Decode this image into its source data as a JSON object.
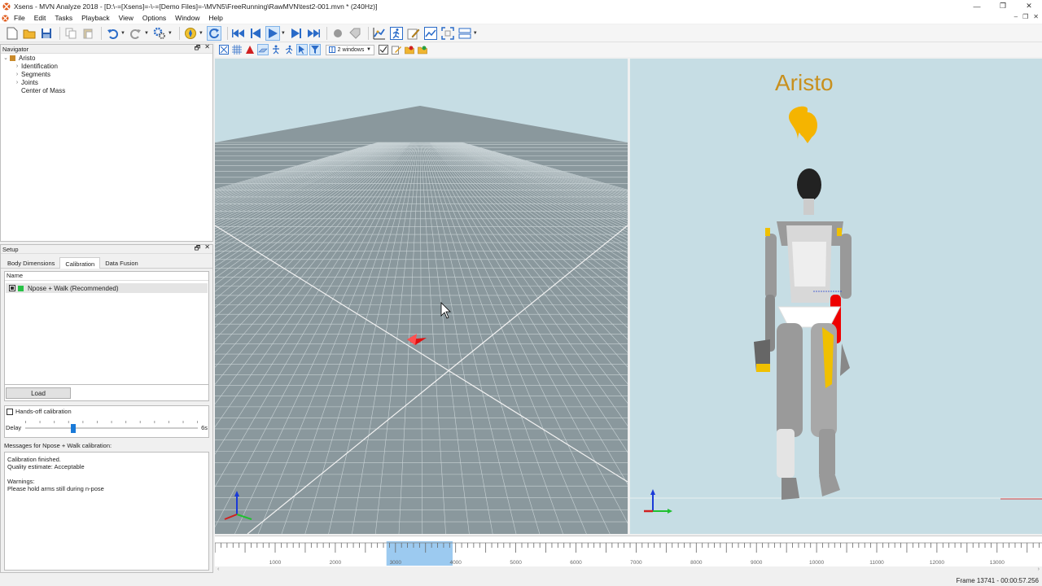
{
  "window": {
    "title": "Xsens - MVN Analyze 2018 - [D:\\-=[Xsens]=-\\-=[Demo Files]=-\\MVN5\\FreeRunning\\RawMVN\\test2-001.mvn * (240Hz)]",
    "minimize": "—",
    "restore": "❐",
    "close": "✕"
  },
  "menu": {
    "items": [
      "File",
      "Edit",
      "Tasks",
      "Playback",
      "View",
      "Options",
      "Window",
      "Help"
    ],
    "mdi_minimize": "–",
    "mdi_restore": "❐",
    "mdi_close": "✕"
  },
  "toolbar2": {
    "windows_select": "2 windows"
  },
  "navigator": {
    "title": "Navigator",
    "float": "🗗",
    "close": "✕",
    "root": "Aristo",
    "children": [
      "Identification",
      "Segments",
      "Joints",
      "Center of Mass"
    ]
  },
  "setup": {
    "title": "Setup",
    "float": "🗗",
    "close": "✕",
    "tabs": [
      "Body Dimensions",
      "Calibration",
      "Data Fusion"
    ],
    "list_header": "Name",
    "calibration_item": "Npose + Walk (Recommended)",
    "load_label": "Load",
    "handsoff_label": "Hands-off calibration",
    "delay_label": "Delay",
    "delay_max": "6s",
    "delay_value": 0.28,
    "messages_header": "Messages for Npose + Walk calibration:",
    "messages": [
      "Calibration finished.",
      "Quality estimate: Acceptable",
      "",
      "Warnings:",
      "Please hold arms still during n-pose"
    ]
  },
  "viewport_right": {
    "character_name": "Aristo"
  },
  "timeline": {
    "labels": [
      "1000",
      "2000",
      "3000",
      "4000",
      "5000",
      "6000",
      "7000",
      "8000",
      "9000",
      "10000",
      "11000",
      "12000",
      "13000"
    ],
    "selection_start": 2850,
    "selection_end": 3950
  },
  "status": {
    "frame": "Frame 13741 - 00:00:57.256"
  },
  "colors": {
    "accent": "#1a7ad8",
    "viewport_bg": "#c6dde4",
    "floor": "#8a989d",
    "character_label": "#c8901e"
  }
}
